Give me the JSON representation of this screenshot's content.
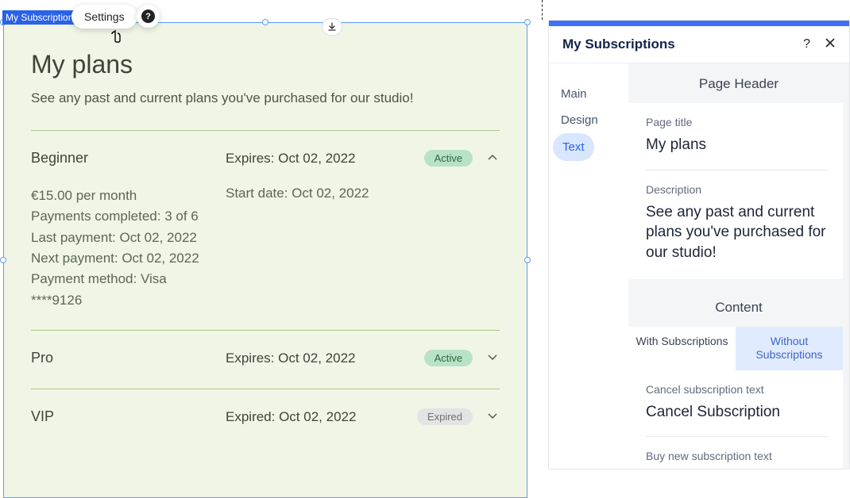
{
  "canvas": {
    "widget_label": "My Subscriptions",
    "settings_label": "Settings",
    "help_glyph": "?",
    "page": {
      "title": "My plans",
      "description": "See any past and current plans you've purchased for our studio!",
      "plans": [
        {
          "name": "Beginner",
          "expire_label": "Expires: Oct 02, 2022",
          "status": "Active",
          "status_kind": "active",
          "expanded": true,
          "details": {
            "price": "€15.00 per month",
            "payments": "Payments completed: 3 of 6",
            "last": "Last payment: Oct 02, 2022",
            "next": "Next payment: Oct 02, 2022",
            "method_line1": "Payment method: Visa",
            "method_line2": "****9126",
            "start": "Start date: Oct 02, 2022"
          }
        },
        {
          "name": "Pro",
          "expire_label": "Expires: Oct 02, 2022",
          "status": "Active",
          "status_kind": "active",
          "expanded": false
        },
        {
          "name": "VIP",
          "expire_label": "Expired: Oct 02, 2022",
          "status": "Expired",
          "status_kind": "expired",
          "expanded": false
        }
      ]
    }
  },
  "panel": {
    "title": "My Subscriptions",
    "tabs": {
      "main": "Main",
      "design": "Design",
      "text": "Text"
    },
    "section1": "Page Header",
    "field_title_label": "Page title",
    "field_title_value": "My plans",
    "field_desc_label": "Description",
    "field_desc_value": "See any past and current plans you've purchased for our studio!",
    "section2": "Content",
    "seg_with": "With Subscriptions",
    "seg_without": "Without Subscriptions",
    "cancel_label": "Cancel subscription text",
    "cancel_value": "Cancel Subscription",
    "buy_label": "Buy new subscription text"
  }
}
